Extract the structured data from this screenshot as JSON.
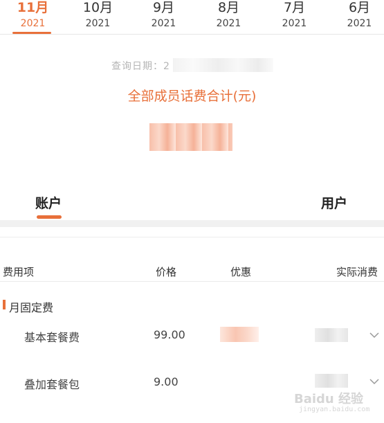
{
  "months": [
    {
      "month": "11月",
      "year": "2021"
    },
    {
      "month": "10月",
      "year": "2021"
    },
    {
      "month": "9月",
      "year": "2021"
    },
    {
      "month": "8月",
      "year": "2021"
    },
    {
      "month": "7月",
      "year": "2021"
    },
    {
      "month": "6月",
      "year": "2021"
    }
  ],
  "query_date_label": "查询日期：2",
  "total_label": "全部成员话费合计(元)",
  "account_tabs": {
    "account": "账户",
    "user": "用户"
  },
  "table_headers": {
    "item": "费用项",
    "price": "价格",
    "discount": "优惠",
    "actual": "实际消费"
  },
  "section": {
    "title": "月固定费"
  },
  "rows": [
    {
      "name": "基本套餐费",
      "price": "99.00"
    },
    {
      "name": "叠加套餐包",
      "price": "9.00"
    }
  ],
  "watermark": {
    "text": "Baidu 经验",
    "sub": "jingyan.baidu.com"
  },
  "colors": {
    "accent": "#e8703a"
  }
}
